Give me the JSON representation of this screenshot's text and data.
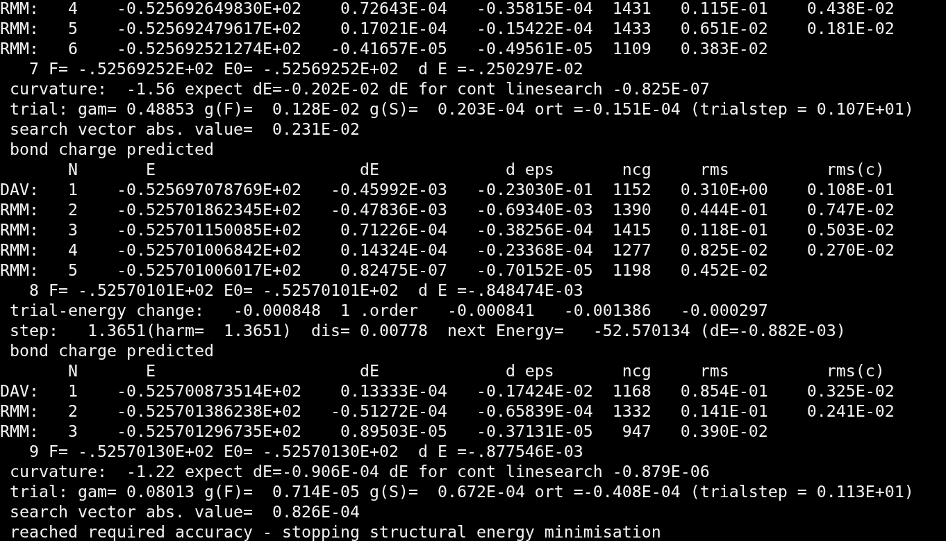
{
  "terminal": {
    "lines": [
      "RMM:   4    -0.525692649830E+02    0.72643E-04   -0.35815E-04  1431   0.115E-01    0.438E-02",
      "RMM:   5    -0.525692479617E+02    0.17021E-04   -0.15422E-04  1433   0.651E-02    0.181E-02",
      "RMM:   6    -0.525692521274E+02   -0.41657E-05   -0.49561E-05  1109   0.383E-02",
      "   7 F= -.52569252E+02 E0= -.52569252E+02  d E =-.250297E-02",
      " curvature:  -1.56 expect dE=-0.202E-02 dE for cont linesearch -0.825E-07",
      " trial: gam= 0.48853 g(F)=  0.128E-02 g(S)=  0.203E-04 ort =-0.151E-04 (trialstep = 0.107E+01)",
      " search vector abs. value=  0.231E-02",
      " bond charge predicted",
      "       N       E                     dE             d eps       ncg     rms          rms(c)",
      "DAV:   1    -0.525697078769E+02   -0.45992E-03   -0.23030E-01  1152   0.310E+00    0.108E-01",
      "RMM:   2    -0.525701862345E+02   -0.47836E-03   -0.69340E-03  1390   0.444E-01    0.747E-02",
      "RMM:   3    -0.525701150085E+02    0.71226E-04   -0.38256E-04  1415   0.118E-01    0.503E-02",
      "RMM:   4    -0.525701006842E+02    0.14324E-04   -0.23368E-04  1277   0.825E-02    0.270E-02",
      "RMM:   5    -0.525701006017E+02    0.82475E-07   -0.70152E-05  1198   0.452E-02",
      "   8 F= -.52570101E+02 E0= -.52570101E+02  d E =-.848474E-03",
      " trial-energy change:   -0.000848  1 .order   -0.000841   -0.001386   -0.000297",
      " step:   1.3651(harm=  1.3651)  dis= 0.00778  next Energy=   -52.570134 (dE=-0.882E-03)",
      " bond charge predicted",
      "       N       E                     dE             d eps       ncg     rms          rms(c)",
      "DAV:   1    -0.525700873514E+02    0.13333E-04   -0.17424E-02  1168   0.854E-01    0.325E-02",
      "RMM:   2    -0.525701386238E+02   -0.51272E-04   -0.65839E-04  1332   0.141E-01    0.241E-02",
      "RMM:   3    -0.525701296735E+02    0.89503E-05   -0.37131E-05   947   0.390E-02",
      "   9 F= -.52570130E+02 E0= -.52570130E+02  d E =-.877546E-03",
      " curvature:  -1.22 expect dE=-0.906E-04 dE for cont linesearch -0.879E-06",
      " trial: gam= 0.08013 g(F)=  0.714E-05 g(S)=  0.672E-04 ort =-0.408E-04 (trialstep = 0.113E+01)",
      " search vector abs. value=  0.826E-04",
      " reached required accuracy - stopping structural energy minimisation"
    ]
  }
}
